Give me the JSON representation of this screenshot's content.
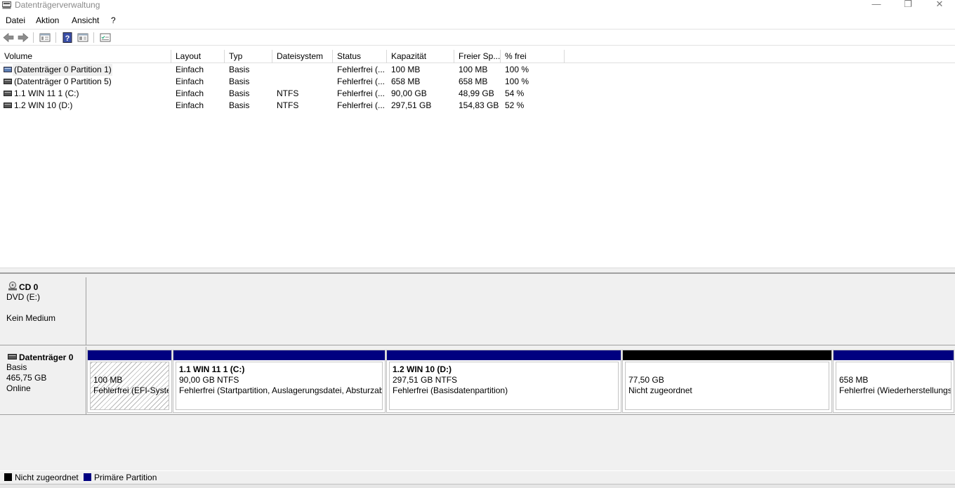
{
  "window": {
    "title": "Datenträgerverwaltung",
    "minimize": "—",
    "restore": "❐",
    "close": "✕"
  },
  "menu": {
    "items": [
      "Datei",
      "Aktion",
      "Ansicht",
      "?"
    ]
  },
  "toolbar": {
    "icons": [
      "back-arrow-icon",
      "forward-arrow-icon",
      "properties-icon",
      "help-icon",
      "console-icon",
      "checklist-icon"
    ]
  },
  "volume_list": {
    "columns": [
      "Volume",
      "Layout",
      "Typ",
      "Dateisystem",
      "Status",
      "Kapazität",
      "Freier Sp...",
      "% frei"
    ],
    "rows": [
      {
        "volume": "(Datenträger 0 Partition 1)",
        "layout": "Einfach",
        "typ": "Basis",
        "dateisystem": "",
        "status": "Fehlerfrei (...",
        "kapazitaet": "100 MB",
        "frei": "100 MB",
        "prozent": "100 %"
      },
      {
        "volume": "(Datenträger 0 Partition 5)",
        "layout": "Einfach",
        "typ": "Basis",
        "dateisystem": "",
        "status": "Fehlerfrei (...",
        "kapazitaet": "658 MB",
        "frei": "658 MB",
        "prozent": "100 %"
      },
      {
        "volume": "1.1 WIN 11 1 (C:)",
        "layout": "Einfach",
        "typ": "Basis",
        "dateisystem": "NTFS",
        "status": "Fehlerfrei (...",
        "kapazitaet": "90,00 GB",
        "frei": "48,99 GB",
        "prozent": "54 %"
      },
      {
        "volume": "1.2 WIN 10 (D:)",
        "layout": "Einfach",
        "typ": "Basis",
        "dateisystem": "NTFS",
        "status": "Fehlerfrei (...",
        "kapazitaet": "297,51 GB",
        "frei": "154,83 GB",
        "prozent": "52 %"
      }
    ]
  },
  "cd0": {
    "name": "CD 0",
    "line1": "DVD (E:)",
    "line2": "Kein Medium"
  },
  "disk0": {
    "name": "Datenträger 0",
    "type": "Basis",
    "size": "465,75 GB",
    "state": "Online",
    "partitions": [
      {
        "name": "",
        "size": "100 MB",
        "status": "Fehlerfrei (EFI-Systempartition)"
      },
      {
        "name": "1.1 WIN 11 1  (C:)",
        "size": "90,00 GB NTFS",
        "status": "Fehlerfrei (Startpartition, Auslagerungsdatei, Absturzabbild, Primäre Partition)"
      },
      {
        "name": "1.2 WIN 10  (D:)",
        "size": "297,51 GB NTFS",
        "status": "Fehlerfrei (Basisdatenpartition)"
      },
      {
        "name": "",
        "size": "77,50 GB",
        "status": "Nicht zugeordnet"
      },
      {
        "name": "",
        "size": "658 MB",
        "status": "Fehlerfrei (Wiederherstellungspartition)"
      }
    ]
  },
  "legend": {
    "unallocated": "Nicht zugeordnet",
    "primary": "Primäre Partition"
  },
  "colors": {
    "primary": "#000080",
    "unallocated": "#000000"
  }
}
